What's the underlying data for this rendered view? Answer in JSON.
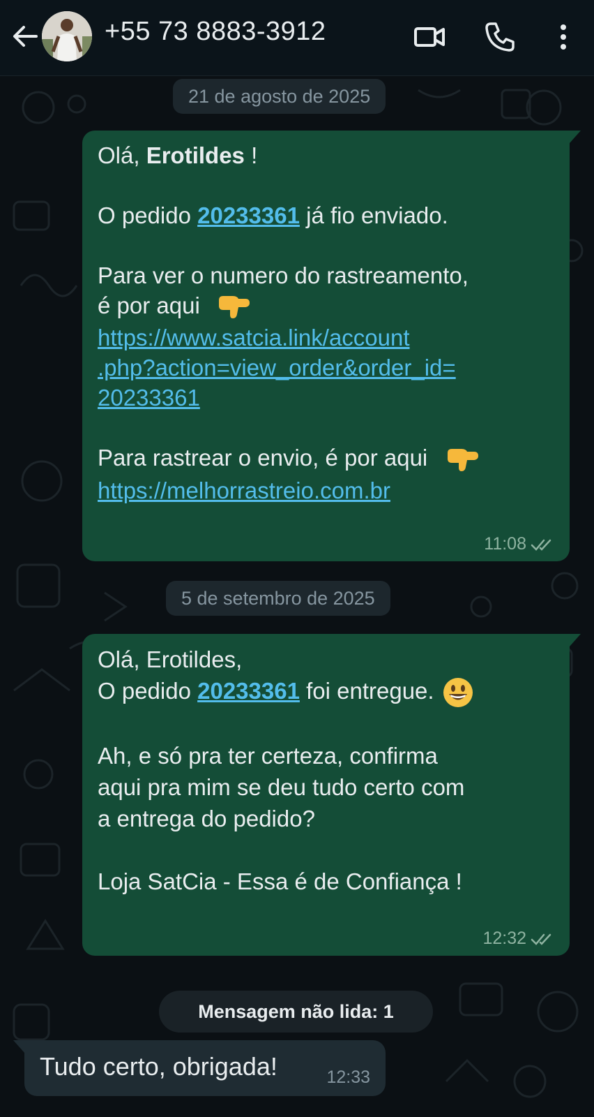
{
  "header": {
    "contact_name": "+55 73 8883-3912"
  },
  "dates": {
    "first": "21 de agosto de 2025",
    "second": "5 de setembro de 2025"
  },
  "message1": {
    "greeting_prefix": "Olá, ",
    "greeting_name": "Erotildes",
    "greeting_suffix": " !",
    "order_prefix": "O pedido ",
    "order_number": "20233361",
    "order_suffix": " já fio enviado.",
    "tracking_line1": "Para ver o numero do rastreamento,",
    "tracking_line2": "é por aqui",
    "link1_line1": "https://www.satcia.link/account",
    "link1_line2": ".php?action=view_order&order_id=",
    "link1_line3": "20233361",
    "track_ship_text": "Para rastrear o envio, é por aqui",
    "link2": "https://melhorrastreio.com.br",
    "time": "11:08"
  },
  "message2": {
    "line1": "Olá, Erotildes,",
    "order_prefix": "O pedido ",
    "order_number": "20233361",
    "order_suffix": " foi entregue.",
    "ask_line1": "Ah, e só pra ter certeza, confirma",
    "ask_line2": "aqui pra mim se deu tudo certo com",
    "ask_line3": "a entrega do pedido?",
    "signature": "Loja SatCia - Essa é de Confiança !",
    "time": "12:32"
  },
  "unread_label": "Mensagem não lida: 1",
  "reply": {
    "text": "Tudo certo, obrigada!",
    "time": "12:33"
  },
  "colors": {
    "header_bg": "#0b141a",
    "outgoing_bubble": "#144d37",
    "incoming_bubble": "#1f2c33",
    "link": "#53bdeb",
    "text": "#e9edef"
  },
  "icons": [
    "back-arrow-icon",
    "video-call-icon",
    "phone-icon",
    "more-options-icon",
    "pointing-down-emoji",
    "grinning-face-emoji",
    "double-check-icon"
  ]
}
